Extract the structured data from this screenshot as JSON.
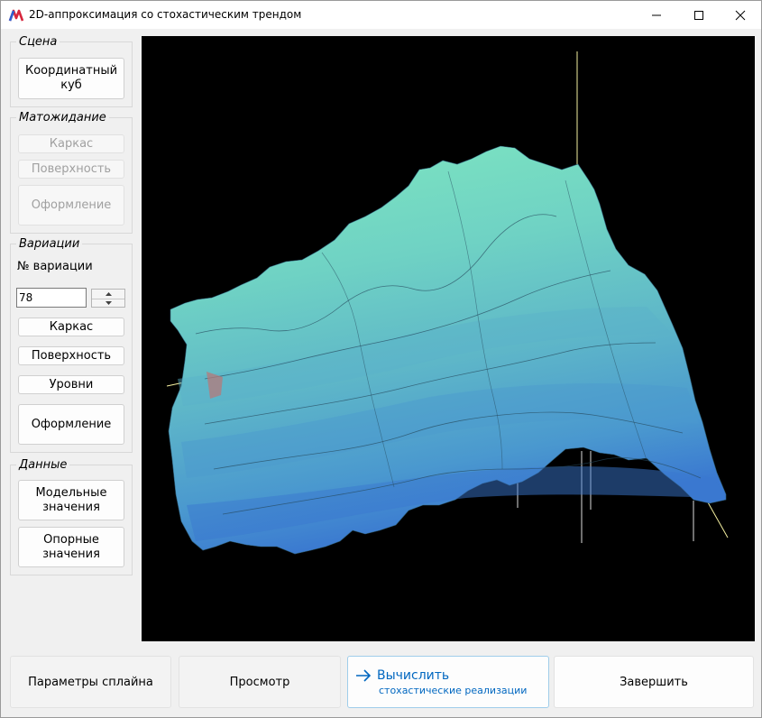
{
  "window": {
    "title": "2D-аппроксимация со стохастическим трендом",
    "icons": {
      "app": "app-logo-icon",
      "minimize": "minimize-icon",
      "maximize": "maximize-icon",
      "close": "close-icon"
    }
  },
  "scene": {
    "legend": "Сцена",
    "cube_button": "Координатный куб"
  },
  "expectation": {
    "legend": "Матожидание",
    "frame_button": "Каркас",
    "surface_button": "Поверхность",
    "style_button": "Оформление"
  },
  "variations": {
    "legend": "Вариации",
    "number_label": "№ вариации",
    "number_value": "78",
    "frame_button": "Каркас",
    "surface_button": "Поверхность",
    "levels_button": "Уровни",
    "style_button": "Оформление"
  },
  "data_group": {
    "legend": "Данные",
    "model_button": "Модельные значения",
    "reference_button": "Опорные значения"
  },
  "bottom": {
    "spline_button": "Параметры сплайна",
    "preview_button": "Просмотр",
    "compute_button": "Вычислить",
    "compute_note": "стохастические реализации",
    "finish_button": "Завершить"
  },
  "colors": {
    "viewport_bg": "#000000",
    "surface_high": "#7fe7c0",
    "surface_mid": "#5fb8c8",
    "surface_low": "#3a78d0",
    "axis_line": "#f5f0a0",
    "accent": "#0067c0"
  }
}
